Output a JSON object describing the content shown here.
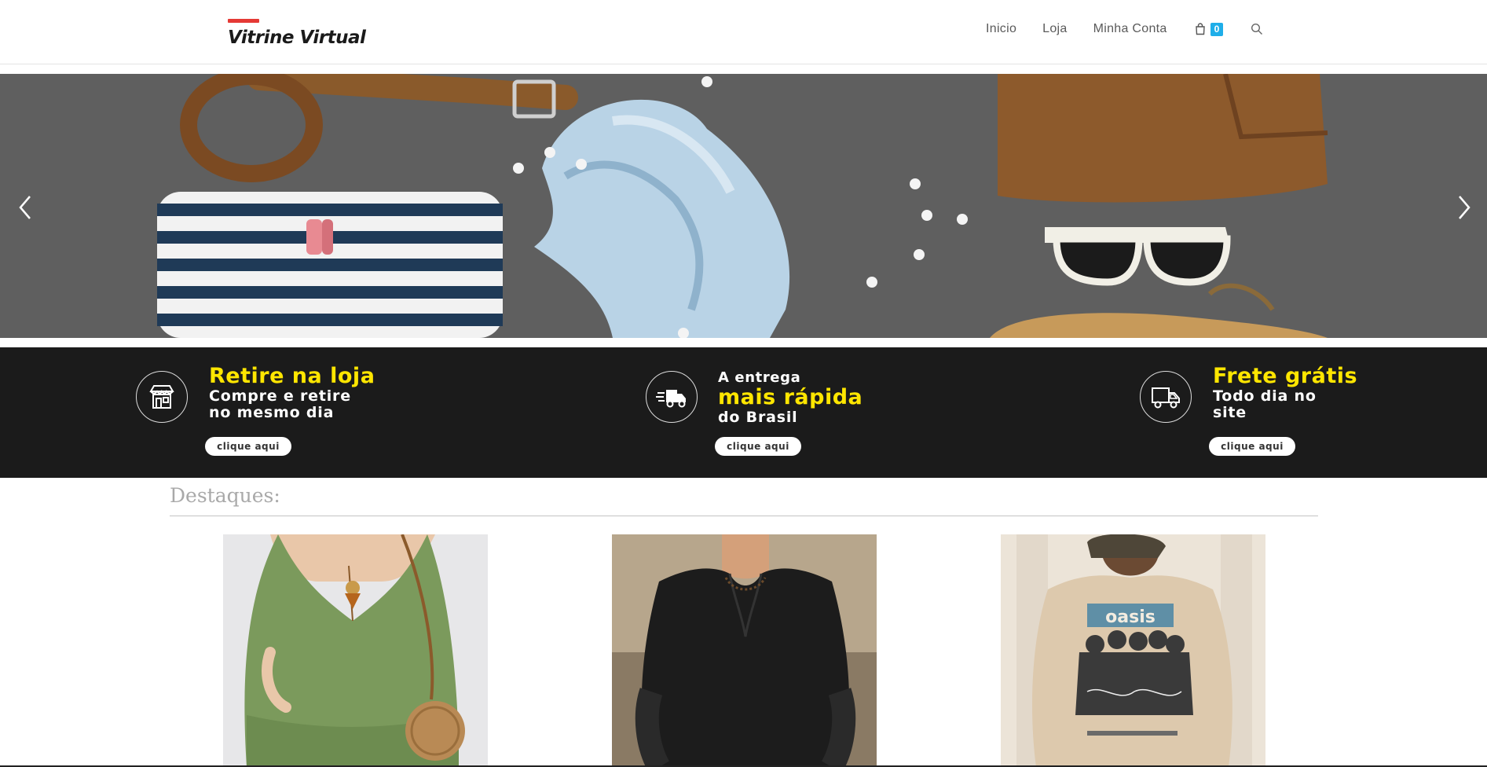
{
  "brand": {
    "name": "Vitrine Virtual",
    "accent": "#e53935"
  },
  "nav": {
    "items": [
      {
        "label": "Inicio"
      },
      {
        "label": "Loja"
      },
      {
        "label": "Minha Conta"
      }
    ],
    "cart_count": "0",
    "cart_badge_color": "#1faee9"
  },
  "hero": {
    "prev_icon": "chevron-left-icon",
    "next_icon": "chevron-right-icon"
  },
  "features": [
    {
      "icon": "store-icon",
      "title": "Retire na loja",
      "line1": "Compre e retire",
      "line2": "no mesmo dia",
      "button": "clique aqui"
    },
    {
      "icon": "fast-delivery-icon",
      "pre": "A entrega",
      "title": "mais rápida",
      "line1": "do Brasil",
      "button": "clique aqui"
    },
    {
      "icon": "truck-icon",
      "title": "Frete grátis",
      "line1": "Todo dia no",
      "line2": "site",
      "button": "clique aqui"
    }
  ],
  "highlight_color": "#ffe600",
  "section": {
    "title": "Destaques:"
  },
  "products": [
    {
      "image": "green-dress-photo"
    },
    {
      "image": "black-shirt-photo"
    },
    {
      "image": "oasis-tshirt-photo"
    }
  ]
}
